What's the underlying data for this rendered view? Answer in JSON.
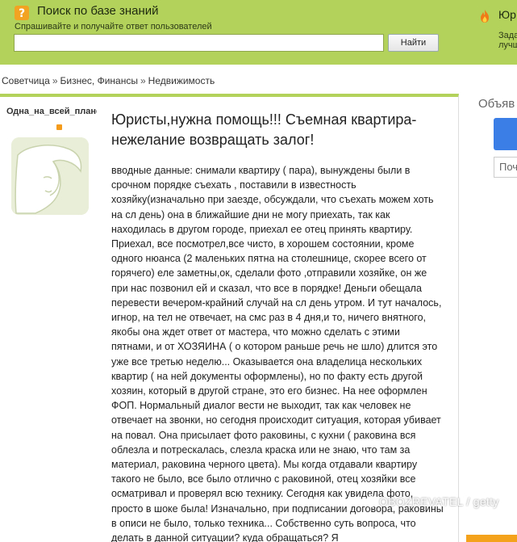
{
  "header": {
    "title": "Поиск по базе знаний",
    "subtitle": "Спрашивайте и получайте ответ пользователей",
    "search_value": "",
    "search_button": "Найти",
    "right_name": "Юр",
    "right_line1": "Зада",
    "right_line2": "лучш"
  },
  "breadcrumb": {
    "items": [
      "Советчица",
      "Бизнес, Финансы",
      "Недвижимость"
    ],
    "separator": "»"
  },
  "question": {
    "author": "Одна_на_всей_плане",
    "title": "Юристы,нужна помощь!!! Съемная квартира-нежелание возвращать залог!",
    "body": "вводные данные: снимали квартиру ( пара), вынуждены были в срочном порядке съехать , поставили в известность хозяйку(изначально при заезде, обсуждали, что съехать можем хоть на сл день) она в ближайшие дни не могу приехать, так как находилась в другом городе, приехал ее отец принять квартиру. Приехал, все посмотрел,все чисто, в хорошем состоянии, кроме одного нюанса (2 маленьких пятна на столешнице, скорее всего от горячего) еле заметны,ок, сделали фото ,отправили хозяйке, он же при нас позвонил ей и сказал, что все в порядке! Деньги обещала перевести вечером-крайний случай на сл день утром. И тут началось, игнор, на тел не отвечает, на смс раз в 4 дня,и то, ничего внятного, якобы она ждет ответ от мастера, что можно сделать с этими пятнами, и от ХОЗЯИНА ( о котором раньше речь не шло) длится это уже все третью неделю... Оказывается она владелица нескольких квартир ( на ней документы оформлены), но по факту есть другой хозяин, который в другой стране, это его бизнес. На нее оформлен ФОП. Нормальный диалог вести не выходит, так как человек не отвечает на звонки, но сегодня происходит ситуация, которая убивает на повал. Она присылает фото раковины, с кухни ( раковина вся облезла и потрескалась, слезла краска или не знаю, что там за материал, раковина черного цвета). Мы когда отдавали квартиру такого не было, все было отлично с раковиной, отец хозяйки все осматривал и проверял всю технику. Сегодня как увидела фото, просто в шоке была! Изначально, при подписании договора, раковины в описи не было, только техника... Собственно суть вопроса, что делать в данной ситуации? куда обращаться? Я"
  },
  "side": {
    "heading": "Объяв",
    "field": "Поч"
  },
  "watermark": "OBOZREVATEL / getty",
  "colors": {
    "banner": "#b2d25b",
    "accent_orange": "#f49b1b",
    "side_button": "#3b7ee6"
  },
  "icons": [
    "question-icon",
    "fire-icon",
    "avatar-silhouette-icon"
  ]
}
